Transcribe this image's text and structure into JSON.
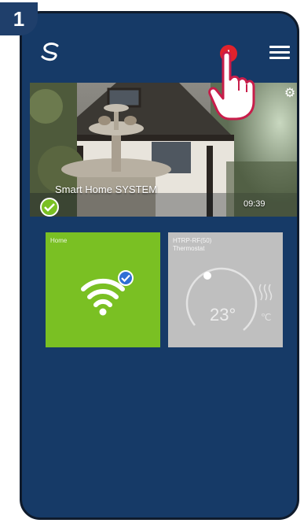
{
  "step_number": "1",
  "header": {
    "logo_icon": "salus-logo-icon",
    "alert_label": "!",
    "menu_icon": "hamburger-menu-icon"
  },
  "camera": {
    "label": "Smart Home SYSTEM",
    "time": "09:39",
    "status_icon": "check-circle-icon",
    "settings_icon": "gear-icon"
  },
  "tiles": [
    {
      "title": "Home",
      "icon": "wifi-icon",
      "badge_icon": "check-badge-icon",
      "color": "#7ac023"
    },
    {
      "title": "HTRP-RF(50)",
      "subtitle": "Thermostat",
      "value": "23°",
      "color": "#bfbfbf"
    }
  ],
  "colors": {
    "background": "#163a67",
    "alert": "#e0222c",
    "accent_green": "#7ac023"
  }
}
